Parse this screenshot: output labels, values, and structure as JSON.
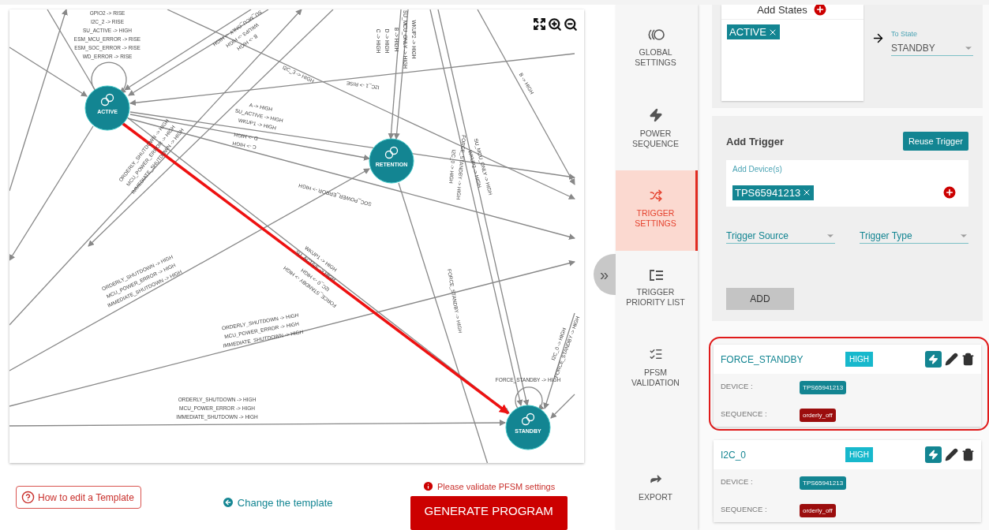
{
  "diagram": {
    "states": [
      {
        "name": "ACTIVE"
      },
      {
        "name": "RETENTION"
      },
      {
        "name": "STANDBY"
      }
    ],
    "edge_labels": [
      {
        "lines": [
          "GPIO2 -> RISE",
          "I2C_2 -> RISE",
          "SU_ACTIVE -> HIGH",
          "ESM_MCU_ERROR -> RISE",
          "ESM_SOC_ERROR -> RISE",
          "WD_ERROR -> RISE"
        ]
      },
      {
        "lines": [
          "A -> HIGH",
          "SU_ACTIVE -> HIGH",
          "WKUP1 -> HIGH"
        ]
      },
      {
        "lines": [
          "C -> HIGH",
          "D -> HIGH"
        ]
      },
      {
        "lines": [
          "ORDERLY_SHUTDOWN -> HIGH",
          "MCU_POWER_ERROR -> HIGH",
          "IMMEDIATE_SHUTDOWN -> HIGH"
        ]
      },
      {
        "lines": [
          "I2C_3 -> HIGH"
        ]
      },
      {
        "lines": [
          "B -> HIGH",
          "WKUP3 -> HIGH",
          "SU_MCU_ONLY -> HIGH"
        ]
      },
      {
        "lines": [
          "I2C_1 -> RISE"
        ]
      },
      {
        "lines": [
          "D -> HIGH",
          "C -> HIGH"
        ]
      },
      {
        "lines": [
          "WKUP2 -> HIGH",
          "SU_MCU_ONLY -> HIGH",
          "B -> HIGH"
        ]
      },
      {
        "lines": [
          "B -> HIGH"
        ]
      },
      {
        "lines": [
          "SOC_POWER_ERROR -> HIGH"
        ]
      },
      {
        "lines": [
          "FORCE_STANDBY -> HIGH",
          "I2C_0 -> HIGH"
        ]
      },
      {
        "lines": [
          "SU_MCU_ONLY -> HIGH",
          "WKUP2 -> HIGH"
        ]
      },
      {
        "lines": [
          "ORDERLY_SHUTDOWN -> HIGH",
          "MCU_POWER_ERROR -> HIGH",
          "IMMEDIATE_SHUTDOWN -> HIGH"
        ]
      },
      {
        "lines": [
          "ORDERLY_SHUTDOWN -> HIGH",
          "MCU_POWER_ERROR -> HIGH",
          "IMMEDIATE_SHUTDOWN -> HIGH"
        ]
      },
      {
        "lines": [
          "ORDERLY_SHUTDOWN -> HIGH",
          "MCU_POWER_ERROR -> HIGH",
          "IMMEDIATE_SHUTDOWN -> HIGH"
        ]
      },
      {
        "lines": [
          "WKUP1 -> HIGH",
          "SU_ACTIVE -> HIGH"
        ]
      },
      {
        "lines": [
          "FORCE_STANDBY -> HIGH",
          "I2C_0 -> HIGH"
        ]
      },
      {
        "lines": [
          "FORCE_STANDBY -> HIGH"
        ]
      },
      {
        "lines": [
          "I2C_0 -> HIGH",
          "FORCE_STANDBY -> HIGH"
        ]
      },
      {
        "lines": [
          "FORCE_STANDBY -> HIGH"
        ]
      }
    ]
  },
  "sidebar": {
    "collapse_toggle": "»",
    "items": [
      {
        "label": "GLOBAL SETTINGS",
        "selected": false
      },
      {
        "label": "POWER SEQUENCE",
        "selected": false
      },
      {
        "label": "TRIGGER SETTINGS",
        "selected": true
      },
      {
        "label": "TRIGGER PRIORITY LIST",
        "selected": false
      },
      {
        "label": "PFSM VALIDATION",
        "selected": false
      },
      {
        "label": "EXPORT",
        "selected": false
      }
    ]
  },
  "states_panel": {
    "title": "Add States",
    "from_states": [
      "ACTIVE"
    ],
    "to_state": {
      "label": "To State",
      "value": "STANDBY"
    }
  },
  "trigger_form": {
    "title": "Add Trigger",
    "reuse_button": "Reuse Trigger",
    "devices": {
      "label": "Add Device(s)",
      "chips": [
        "TPS65941213"
      ]
    },
    "trigger_source": {
      "placeholder": "Trigger Source"
    },
    "trigger_type": {
      "placeholder": "Trigger Type"
    },
    "add_button": {
      "label": "ADD",
      "disabled": true
    }
  },
  "triggers": [
    {
      "name": "FORCE_STANDBY",
      "level": "HIGH",
      "highlighted": true,
      "device_label": "DEVICE :",
      "device": "TPS65941213",
      "sequence_label": "SEQUENCE :",
      "sequence": "orderly_off"
    },
    {
      "name": "I2C_0",
      "level": "HIGH",
      "highlighted": false,
      "device_label": "DEVICE :",
      "device": "TPS65941213",
      "sequence_label": "SEQUENCE :",
      "sequence": "orderly_off"
    }
  ],
  "footer": {
    "help_button": "How to edit a Template",
    "change_link": "Change the template",
    "warning": "Please validate PFSM settings",
    "generate_button": "GENERATE PROGRAM"
  }
}
